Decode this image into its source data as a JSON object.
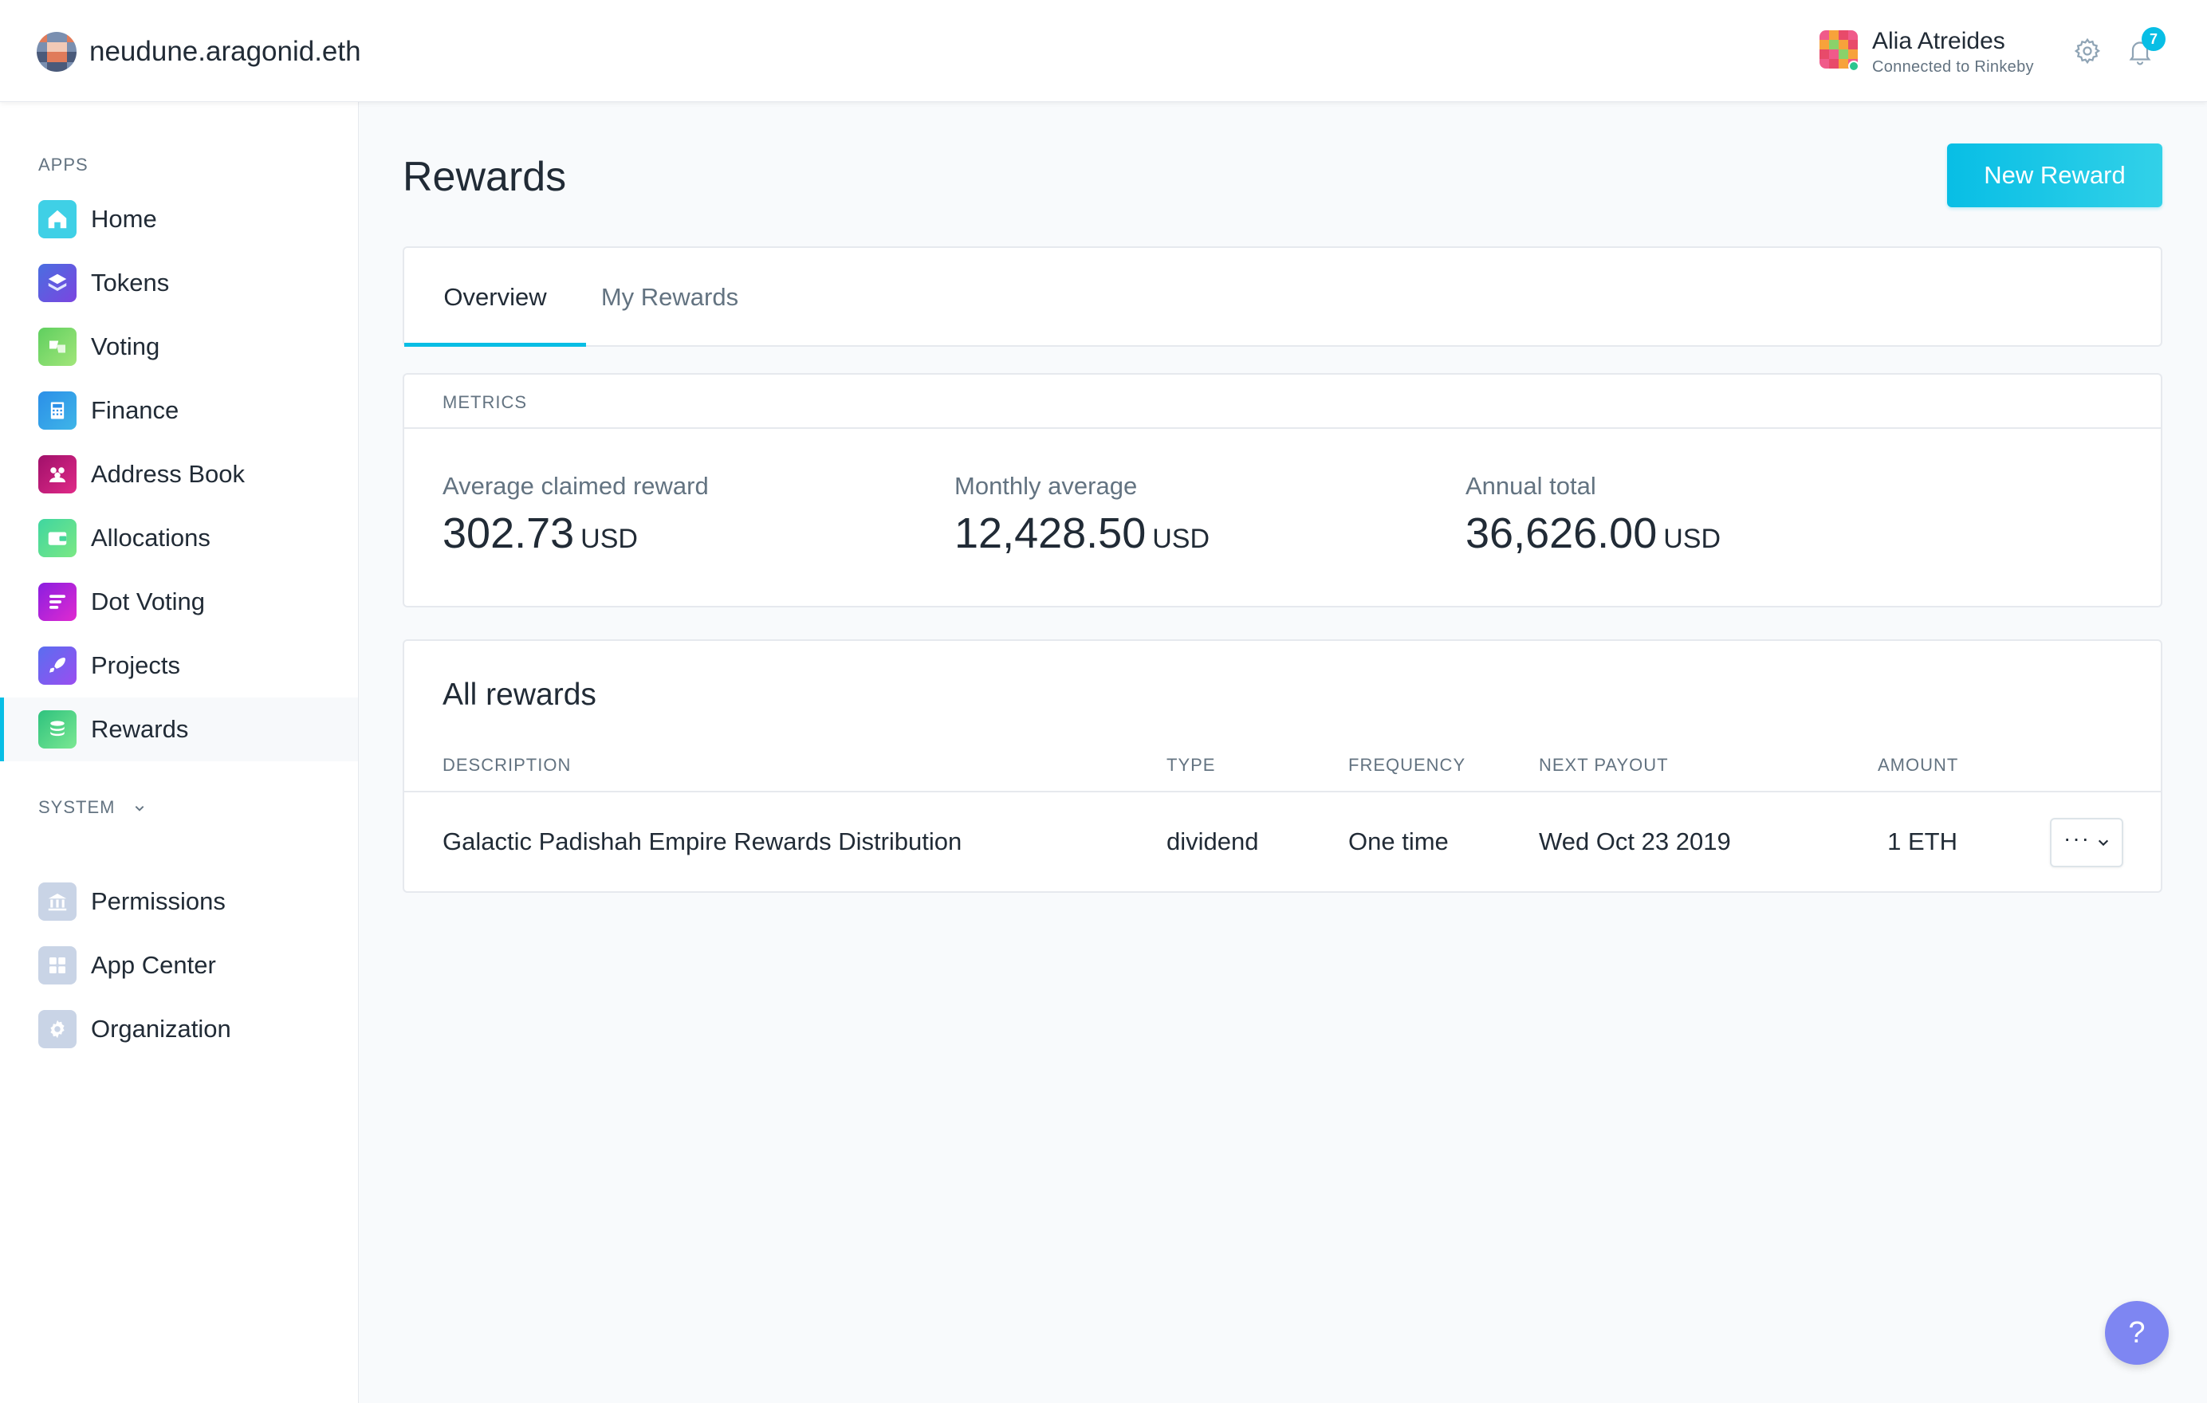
{
  "header": {
    "org_name": "neudune.aragonid.eth",
    "user_name": "Alia Atreides",
    "user_network": "Connected to Rinkeby",
    "notification_count": "7"
  },
  "sidebar": {
    "apps_label": "APPS",
    "system_label": "SYSTEM",
    "apps": [
      {
        "label": "Home",
        "icon": "home-icon",
        "color": "#3fd0e6"
      },
      {
        "label": "Tokens",
        "icon": "tokens-icon",
        "color": "#5a5ee0"
      },
      {
        "label": "Voting",
        "icon": "voting-icon",
        "color": "#6ad16a"
      },
      {
        "label": "Finance",
        "icon": "finance-icon",
        "color": "#2b8fe8"
      },
      {
        "label": "Address Book",
        "icon": "address-book-icon",
        "color": "#c3127a"
      },
      {
        "label": "Allocations",
        "icon": "allocations-icon",
        "color": "#45d69a"
      },
      {
        "label": "Dot Voting",
        "icon": "dot-voting-icon",
        "color": "#b61ee0"
      },
      {
        "label": "Projects",
        "icon": "projects-icon",
        "color": "#6e5cf0"
      },
      {
        "label": "Rewards",
        "icon": "rewards-icon",
        "color": "#37d07e"
      }
    ],
    "system": [
      {
        "label": "Permissions",
        "icon": "permissions-icon",
        "color": "#c9d4e6"
      },
      {
        "label": "App Center",
        "icon": "app-center-icon",
        "color": "#c9d4e6"
      },
      {
        "label": "Organization",
        "icon": "organization-icon",
        "color": "#c9d4e6"
      }
    ],
    "active_app": "Rewards"
  },
  "main": {
    "title": "Rewards",
    "new_reward_label": "New Reward",
    "tabs": [
      {
        "label": "Overview",
        "active": true
      },
      {
        "label": "My Rewards",
        "active": false
      }
    ],
    "metrics": {
      "header": "METRICS",
      "items": [
        {
          "label": "Average claimed reward",
          "value": "302.73",
          "unit": "USD"
        },
        {
          "label": "Monthly average",
          "value": "12,428.50",
          "unit": "USD"
        },
        {
          "label": "Annual total",
          "value": "36,626.00",
          "unit": "USD"
        }
      ]
    },
    "rewards": {
      "title": "All rewards",
      "columns": [
        "DESCRIPTION",
        "TYPE",
        "FREQUENCY",
        "NEXT PAYOUT",
        "AMOUNT"
      ],
      "rows": [
        {
          "description": "Galactic Padishah Empire Rewards Distribution",
          "type": "dividend",
          "frequency": "One time",
          "next_payout": "Wed Oct 23 2019",
          "amount": "1 ETH"
        }
      ]
    }
  },
  "colors": {
    "accent": "#08bee5",
    "help_button": "#7e86f2",
    "status_online": "#2cc68f"
  },
  "help_label": "?"
}
